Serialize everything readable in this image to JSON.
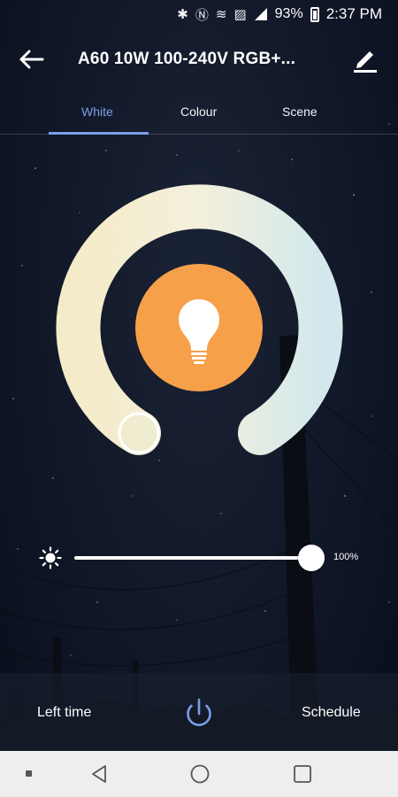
{
  "status_bar": {
    "battery": "93%",
    "time": "2:37 PM",
    "icons": [
      "bluetooth-icon",
      "nfc-icon",
      "wifi-calling-icon",
      "no-sim-icon",
      "signal-icon",
      "battery-icon"
    ]
  },
  "header": {
    "title": "A60 10W 100-240V RGB+...",
    "back_icon": "arrow-left-icon",
    "edit_icon": "pencil-icon"
  },
  "tabs": [
    {
      "label": "White",
      "active": true
    },
    {
      "label": "Colour",
      "active": false
    },
    {
      "label": "Scene",
      "active": false
    }
  ],
  "color_wheel": {
    "warm_color": "#f4ebc8",
    "cool_color": "#d3e8ec",
    "bulb_color": "#f7a04a",
    "bulb_icon": "lightbulb-icon"
  },
  "brightness": {
    "icon": "sun-icon",
    "value": 1.0,
    "label": "100%"
  },
  "bottom": {
    "left_time": "Left time",
    "schedule": "Schedule",
    "power_icon": "power-icon",
    "accent": "#7b9ee8"
  },
  "nav_bar": {
    "icons": [
      "nav-dot-icon",
      "nav-back-icon",
      "nav-home-icon",
      "nav-recent-icon"
    ]
  }
}
